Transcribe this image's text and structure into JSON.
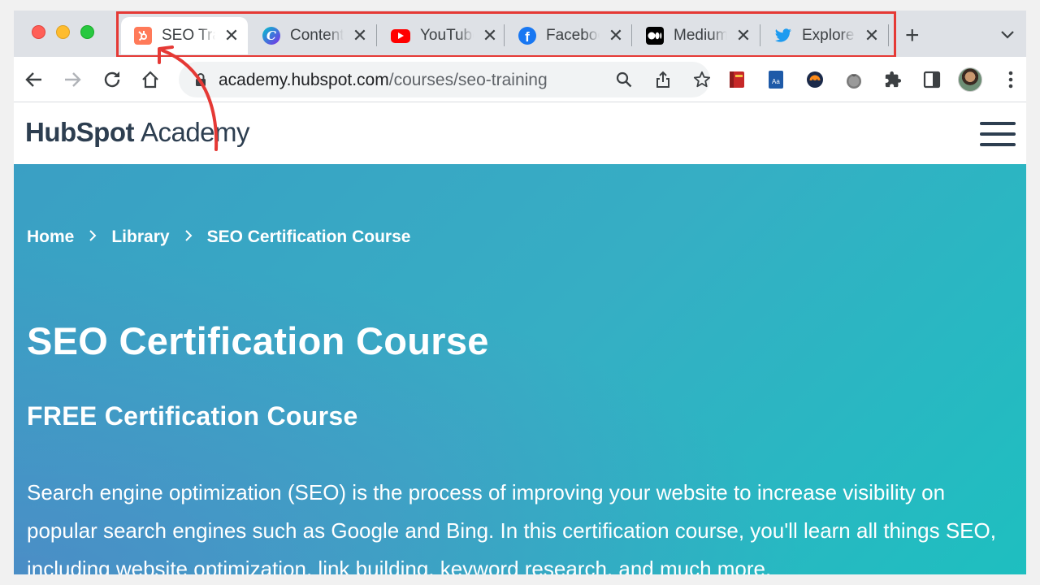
{
  "browser": {
    "tabs": [
      {
        "label": "SEO Training",
        "icon": "hubspot-icon",
        "color": "#ff7a59",
        "active": true
      },
      {
        "label": "Content",
        "icon": "canva-icon",
        "color": "#7d2ae8",
        "active": false
      },
      {
        "label": "YouTube",
        "icon": "youtube-icon",
        "color": "#ff0000",
        "active": false
      },
      {
        "label": "Facebook",
        "icon": "facebook-icon",
        "color": "#1877f2",
        "active": false
      },
      {
        "label": "Medium",
        "icon": "medium-icon",
        "color": "#000000",
        "active": false
      },
      {
        "label": "Explore",
        "icon": "twitter-icon",
        "color": "#1d9bf0",
        "active": false
      }
    ],
    "address": {
      "host": "academy.hubspot.com",
      "path": "/courses/seo-training"
    }
  },
  "site": {
    "logo_brand": "HubSpot",
    "logo_product": "Academy"
  },
  "breadcrumb": {
    "home": "Home",
    "library": "Library",
    "current": "SEO Certification Course"
  },
  "hero": {
    "title": "SEO Certification Course",
    "subtitle": "FREE Certification Course",
    "description": "Search engine optimization (SEO) is the process of improving your website to increase visibility on popular search engines such as Google and Bing. In this certification course, you'll learn all things SEO, including website optimization, link building, keyword research, and much more."
  },
  "colors": {
    "annotation": "#e53935",
    "brand_navy": "#2d3e50",
    "hubspot_orange": "#ff7a59"
  }
}
